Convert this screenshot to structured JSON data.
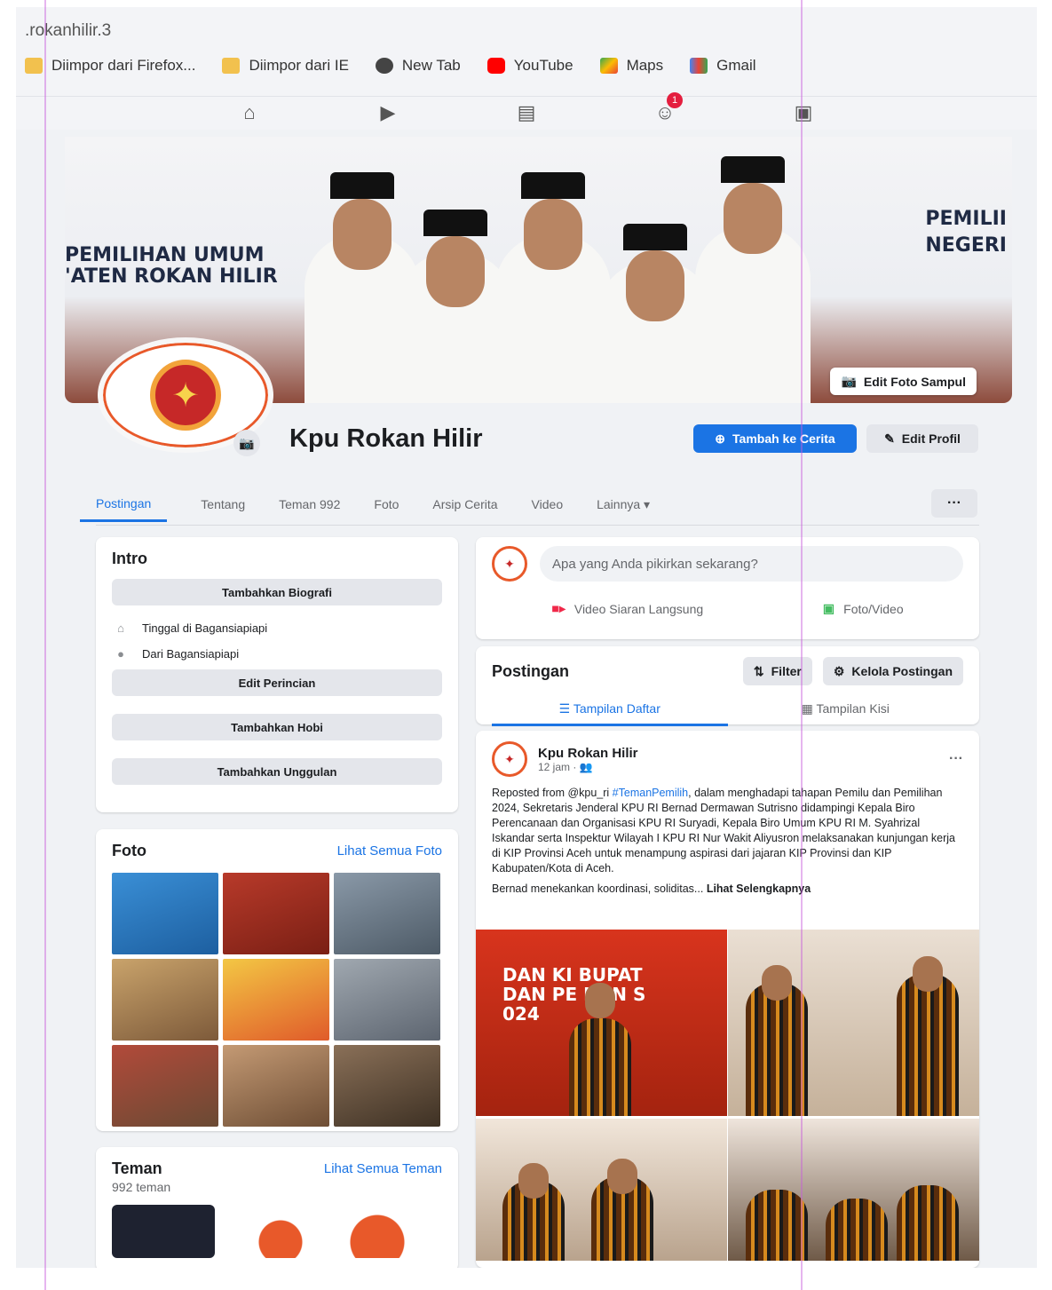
{
  "browser": {
    "url": ".rokanhilir.3",
    "bookmarks": [
      {
        "label": "Diimpor dari Firefox...",
        "icon": "folder-icon",
        "color": "#f2c14e"
      },
      {
        "label": "Diimpor dari IE",
        "icon": "folder-icon",
        "color": "#f2c14e"
      },
      {
        "label": "New Tab",
        "icon": "globe-icon",
        "color": "#444444"
      },
      {
        "label": "YouTube",
        "icon": "youtube-icon",
        "color": "#ff0000"
      },
      {
        "label": "Maps",
        "icon": "maps-icon",
        "color": "#34a853"
      },
      {
        "label": "Gmail",
        "icon": "gmail-icon",
        "color": "#ea4335"
      }
    ]
  },
  "topnav": {
    "icons": [
      "home-icon",
      "video-icon",
      "marketplace-icon",
      "groups-icon",
      "gaming-icon"
    ],
    "badge": "1"
  },
  "cover": {
    "left_line1": "PEMILIHAN UMUM",
    "left_line2": "'ATEN ROKAN HILIR",
    "right_line1": "PEMILII",
    "right_line2": "NEGERI",
    "edit_label": "Edit Foto Sampul"
  },
  "profile": {
    "name": "Kpu Rokan Hilir",
    "add_story": "Tambah ke Cerita",
    "edit_profile": "Edit Profil"
  },
  "tabs": [
    "Postingan",
    "Tentang",
    "Teman 992",
    "Foto",
    "Arsip Cerita",
    "Video",
    "Lainnya ▾"
  ],
  "more_label": "···",
  "intro": {
    "title": "Intro",
    "add_bio": "Tambahkan Biografi",
    "lives_in": "Tinggal di Bagansiapiapi",
    "from": "Dari Bagansiapiapi",
    "edit_details": "Edit Perincian",
    "add_hobby": "Tambahkan Hobi",
    "add_featured": "Tambahkan Unggulan"
  },
  "photos": {
    "title": "Foto",
    "see_all": "Lihat Semua Foto",
    "colors": [
      "#3a8fd6",
      "#b83a2a",
      "#6b7b8c",
      "#c9a36b",
      "#f3c744",
      "#7f8a96",
      "#8a5a3c",
      "#a87a56",
      "#6e5a46"
    ]
  },
  "friends": {
    "title": "Teman",
    "see_all": "Lihat Semua Teman",
    "count": "992 teman"
  },
  "composer": {
    "placeholder": "Apa yang Anda pikirkan sekarang?",
    "live_video": "Video Siaran Langsung",
    "photo_video": "Foto/Video"
  },
  "posts_header": {
    "title": "Postingan",
    "filter": "Filter",
    "manage": "Kelola Postingan",
    "list_view": "Tampilan Daftar",
    "grid_view": "Tampilan Kisi"
  },
  "post": {
    "author": "Kpu Rokan Hilir",
    "time": "12 jam · ",
    "text_prefix": "Reposted from @kpu_ri ",
    "hashtag": "#TemanPemilih",
    "text_body": ", dalam menghadapi tahapan Pemilu dan Pemilihan 2024, Sekretaris Jenderal KPU RI Bernad Dermawan Sutrisno didampingi  Kepala Biro Perencanaan dan Organisasi KPU RI Suryadi, Kepala Biro Umum KPU RI M. Syahrizal Iskandar serta Inspektur Wilayah I KPU RI Nur Wakit Aliyusron melaksanakan kunjungan kerja di KIP Provinsi Aceh untuk menampung aspirasi dari jajaran KIP Provinsi dan KIP Kabupaten/Kota di Aceh.",
    "text_2": "Bernad menekankan koordinasi, soliditas... ",
    "see_more": "Lihat Selengkapnya",
    "image1_text1": "DAN KI   BUPAT",
    "image1_text2": "DAN PE    HAN S",
    "image1_text3": "024"
  }
}
